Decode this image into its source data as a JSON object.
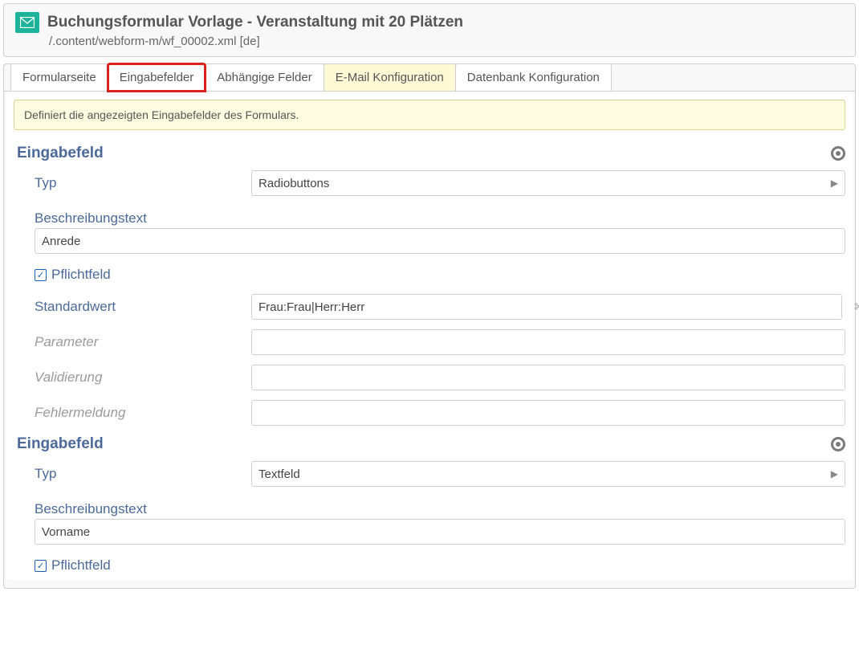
{
  "header": {
    "title": "Buchungsformular Vorlage - Veranstaltung mit 20 Plätzen",
    "path": "/.content/webform-m/wf_00002.xml [de]"
  },
  "tabs": [
    {
      "label": "Formularseite"
    },
    {
      "label": "Eingabefelder"
    },
    {
      "label": "Abhängige Felder"
    },
    {
      "label": "E-Mail Konfiguration"
    },
    {
      "label": "Datenbank Konfiguration"
    }
  ],
  "info": "Definiert die angezeigten Eingabefelder des Formulars.",
  "labels": {
    "section": "Eingabefeld",
    "type": "Typ",
    "desc": "Beschreibungstext",
    "mandatory": "Pflichtfeld",
    "default": "Standardwert",
    "parameter": "Parameter",
    "validation": "Validierung",
    "error": "Fehlermeldung"
  },
  "fields": [
    {
      "type": "Radiobuttons",
      "desc": "Anrede",
      "mandatory": true,
      "default": "Frau:Frau|Herr:Herr",
      "parameter": "",
      "validation": "",
      "error": ""
    },
    {
      "type": "Textfeld",
      "desc": "Vorname",
      "mandatory": true
    }
  ]
}
